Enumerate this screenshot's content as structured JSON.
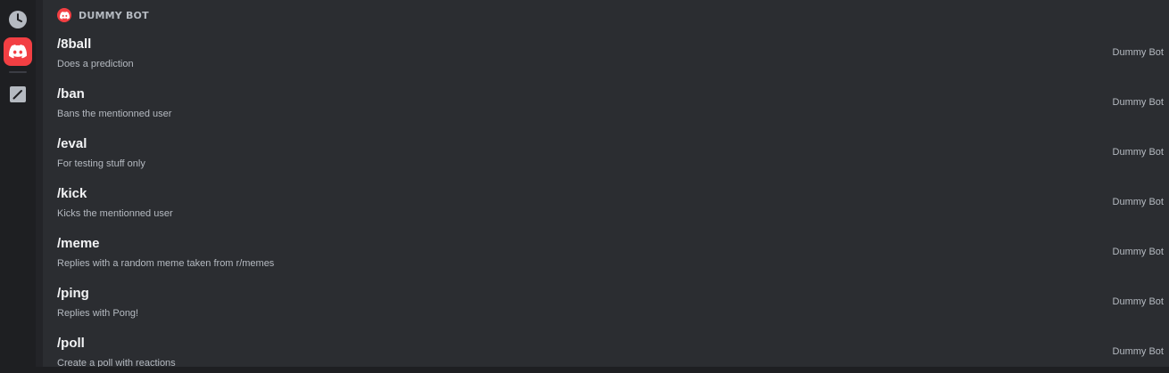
{
  "rail": {
    "items": [
      {
        "icon": "clock-icon"
      },
      {
        "icon": "discord-icon",
        "active": true
      },
      {
        "icon": "edit-icon"
      }
    ],
    "accent": "#f23f43"
  },
  "section": {
    "title": "DUMMY BOT",
    "icon": "discord-icon"
  },
  "commands": [
    {
      "name": "/8ball",
      "description": "Does a prediction",
      "source": "Dummy Bot"
    },
    {
      "name": "/ban",
      "description": "Bans the mentionned user",
      "source": "Dummy Bot"
    },
    {
      "name": "/eval",
      "description": "For testing stuff only",
      "source": "Dummy Bot"
    },
    {
      "name": "/kick",
      "description": "Kicks the mentionned user",
      "source": "Dummy Bot"
    },
    {
      "name": "/meme",
      "description": "Replies with a random meme taken from r/memes",
      "source": "Dummy Bot"
    },
    {
      "name": "/ping",
      "description": "Replies with Pong!",
      "source": "Dummy Bot"
    },
    {
      "name": "/poll",
      "description": "Create a poll with reactions",
      "source": "Dummy Bot"
    }
  ]
}
